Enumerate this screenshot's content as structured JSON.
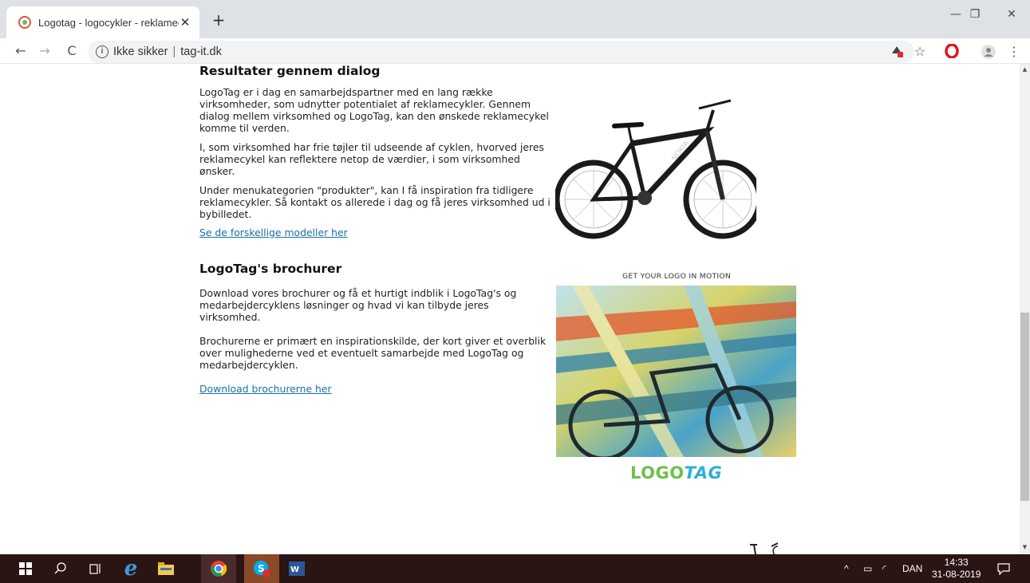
{
  "browser": {
    "tab_title": "Logotag - logocykler - reklamecy",
    "tab_close": "✕",
    "new_tab": "+",
    "url_security": "Ikke sikker",
    "url": "tag-it.dk",
    "win_min": "—",
    "win_restore": "❐",
    "win_close": "✕"
  },
  "section1": {
    "heading": "Resultater gennem dialog",
    "p1": "LogoTag er i dag en samarbejdspartner med en lang række virksomheder, som udnytter potentialet af reklamecykler. Gennem dialog mellem virksomhed og LogoTag, kan den ønskede reklamecykel komme til verden.",
    "p2": "I, som virksomhed har frie tøjler til udseende af cyklen, hvorved jeres reklamecykel kan reflektere netop de værdier, i som virksomhed ønsker.",
    "p3": "Under menukategorien \"produkter\", kan I få inspiration fra tidligere reklamecykler. Så kontakt os allerede i dag og få jeres virksomhed ud i bybilledet.",
    "link": "Se de forskellige modeller her"
  },
  "section2": {
    "heading": "LogoTag's brochurer",
    "p1": "Download vores brochurer og få et hurtigt indblik i LogoTag's og medarbejdercyklens løsninger og hvad vi kan tilbyde jeres virksomhed.",
    "p2": "Brochurerne er primært en inspirationskilde, der kort giver et overblik over mulighederne ved et eventuelt samarbejde med LogoTag og medarbejdercyklen.",
    "link": "Download brochurerne her"
  },
  "images": {
    "bike_brand": "NOKIA",
    "motion_caption": "GET YOUR LOGO IN MOTION",
    "logo_part1": "LOGO",
    "logo_part2": "TAG"
  },
  "taskbar": {
    "lang": "DAN",
    "time": "14:33",
    "date": "31-08-2019"
  },
  "colors": {
    "link": "#1a6fa8",
    "logo_green": "#6cc04a",
    "logo_blue": "#2ab0d6",
    "taskbar": "#2b1414"
  }
}
